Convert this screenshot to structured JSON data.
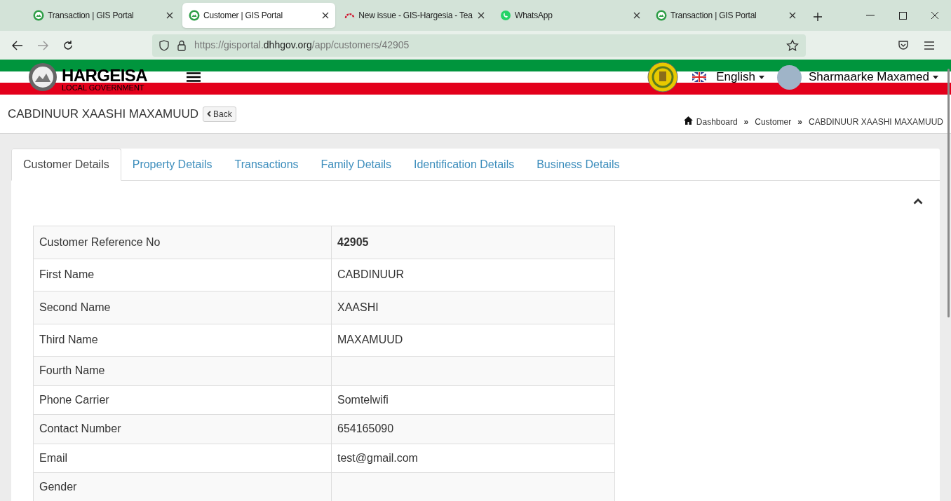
{
  "browser": {
    "tabs": [
      {
        "title": "Transaction | GIS Portal",
        "kind": "gis",
        "selected": false
      },
      {
        "title": "Customer | GIS Portal",
        "kind": "gis",
        "selected": true
      },
      {
        "title": "New issue - GIS-Hargesia - Tea",
        "kind": "issue",
        "selected": false
      },
      {
        "title": "WhatsApp",
        "kind": "whatsapp",
        "selected": false
      },
      {
        "title": "Transaction | GIS Portal",
        "kind": "gis",
        "selected": false
      }
    ],
    "url": {
      "scheme": "https://gisportal.",
      "domain": "dhhgov.org",
      "path": "/app/customers/42905"
    }
  },
  "header": {
    "logo_title": "HARGEISA",
    "logo_subtitle": "LOCAL GOVERNMENT",
    "language": "English",
    "user": "Sharmaarke Maxamed"
  },
  "page": {
    "title": "CABDINUUR XAASHI MAXAMUUD",
    "back": "Back",
    "breadcrumb": [
      {
        "label": "Dashboard"
      },
      {
        "separator": "»",
        "label": "Customer"
      },
      {
        "separator": "»",
        "label": "CABDINUUR XAASHI MAXAMUUD"
      }
    ]
  },
  "tabs": [
    {
      "label": "Customer Details",
      "selected": true
    },
    {
      "label": "Property Details",
      "selected": false
    },
    {
      "label": "Transactions",
      "selected": false
    },
    {
      "label": "Family Details",
      "selected": false
    },
    {
      "label": "Identification Details",
      "selected": false
    },
    {
      "label": "Business Details",
      "selected": false
    }
  ],
  "details": [
    {
      "label": "Customer Reference No",
      "value": "42905",
      "bold": true
    },
    {
      "label": "First Name",
      "value": "CABDINUUR",
      "bold": false
    },
    {
      "label": "Second Name",
      "value": "XAASHI",
      "bold": false
    },
    {
      "label": "Third Name",
      "value": "MAXAMUUD",
      "bold": false
    },
    {
      "label": "Fourth Name"
    },
    {
      "label": "Phone Carrier",
      "value": "Somtelwifi",
      "bold": false
    },
    {
      "label": "Contact Number",
      "value": "654165090",
      "bold": false
    },
    {
      "label": "Email",
      "value": "test@gmail.com",
      "bold": false
    },
    {
      "label": "Gender"
    }
  ]
}
